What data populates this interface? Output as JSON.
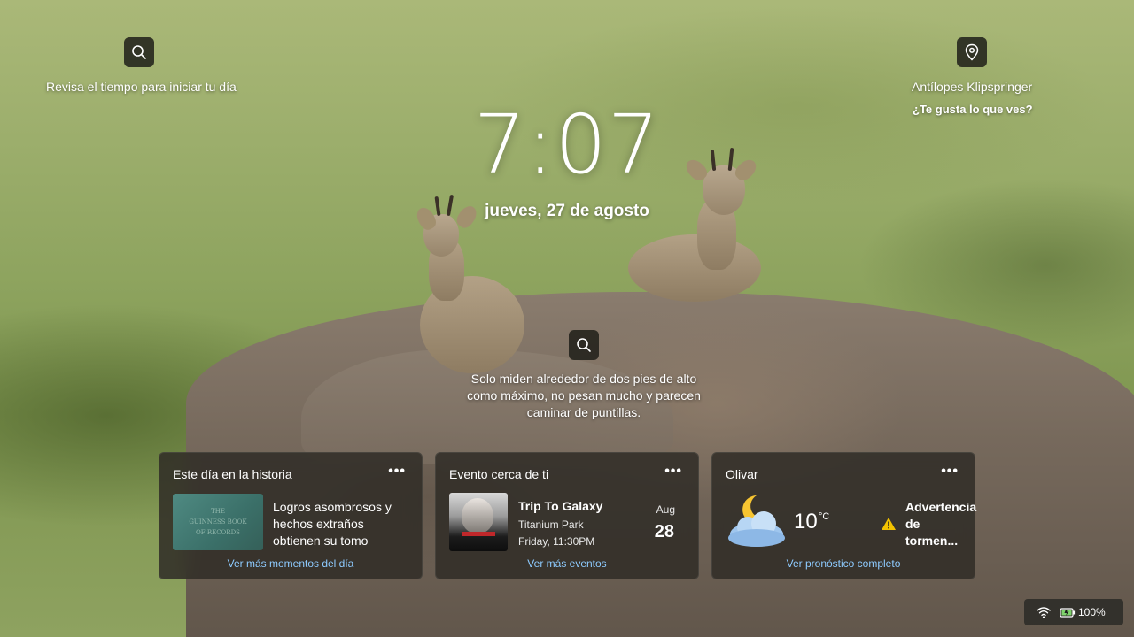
{
  "top_left": {
    "label": "Revisa el tiempo para iniciar tu día"
  },
  "top_right": {
    "title": "Antílopes Klipspringer",
    "question": "¿Te gusta lo que ves?"
  },
  "clock": {
    "time": "7:07",
    "date": "jueves, 27 de agosto"
  },
  "fact": {
    "text": "Solo miden alrededor de dos pies de alto como máximo, no pesan mucho y parecen caminar de puntillas."
  },
  "cards": {
    "history": {
      "title": "Este día en la historia",
      "more": "•••",
      "headline": "Logros asombrosos y hechos extraños obtienen su tomo",
      "thumb_lines": [
        "THE",
        "GUINNESS BOOK",
        "OF RECORDS"
      ],
      "link": "Ver más momentos del día"
    },
    "event": {
      "title": "Evento cerca de ti",
      "more": "•••",
      "name": "Trip To Galaxy",
      "venue": "Titanium Park",
      "time": "Friday, 11:30PM",
      "month": "Aug",
      "day": "28",
      "link": "Ver más eventos"
    },
    "weather": {
      "title": "Olivar",
      "more": "•••",
      "temperature": "10",
      "unit": "°C",
      "alert": "Advertencia de tormen...",
      "link": "Ver pronóstico completo"
    }
  },
  "tray": {
    "battery": "100%"
  },
  "colors": {
    "link": "#8ecbff",
    "card_bg": "#302c26",
    "alert": "#f2c200"
  }
}
